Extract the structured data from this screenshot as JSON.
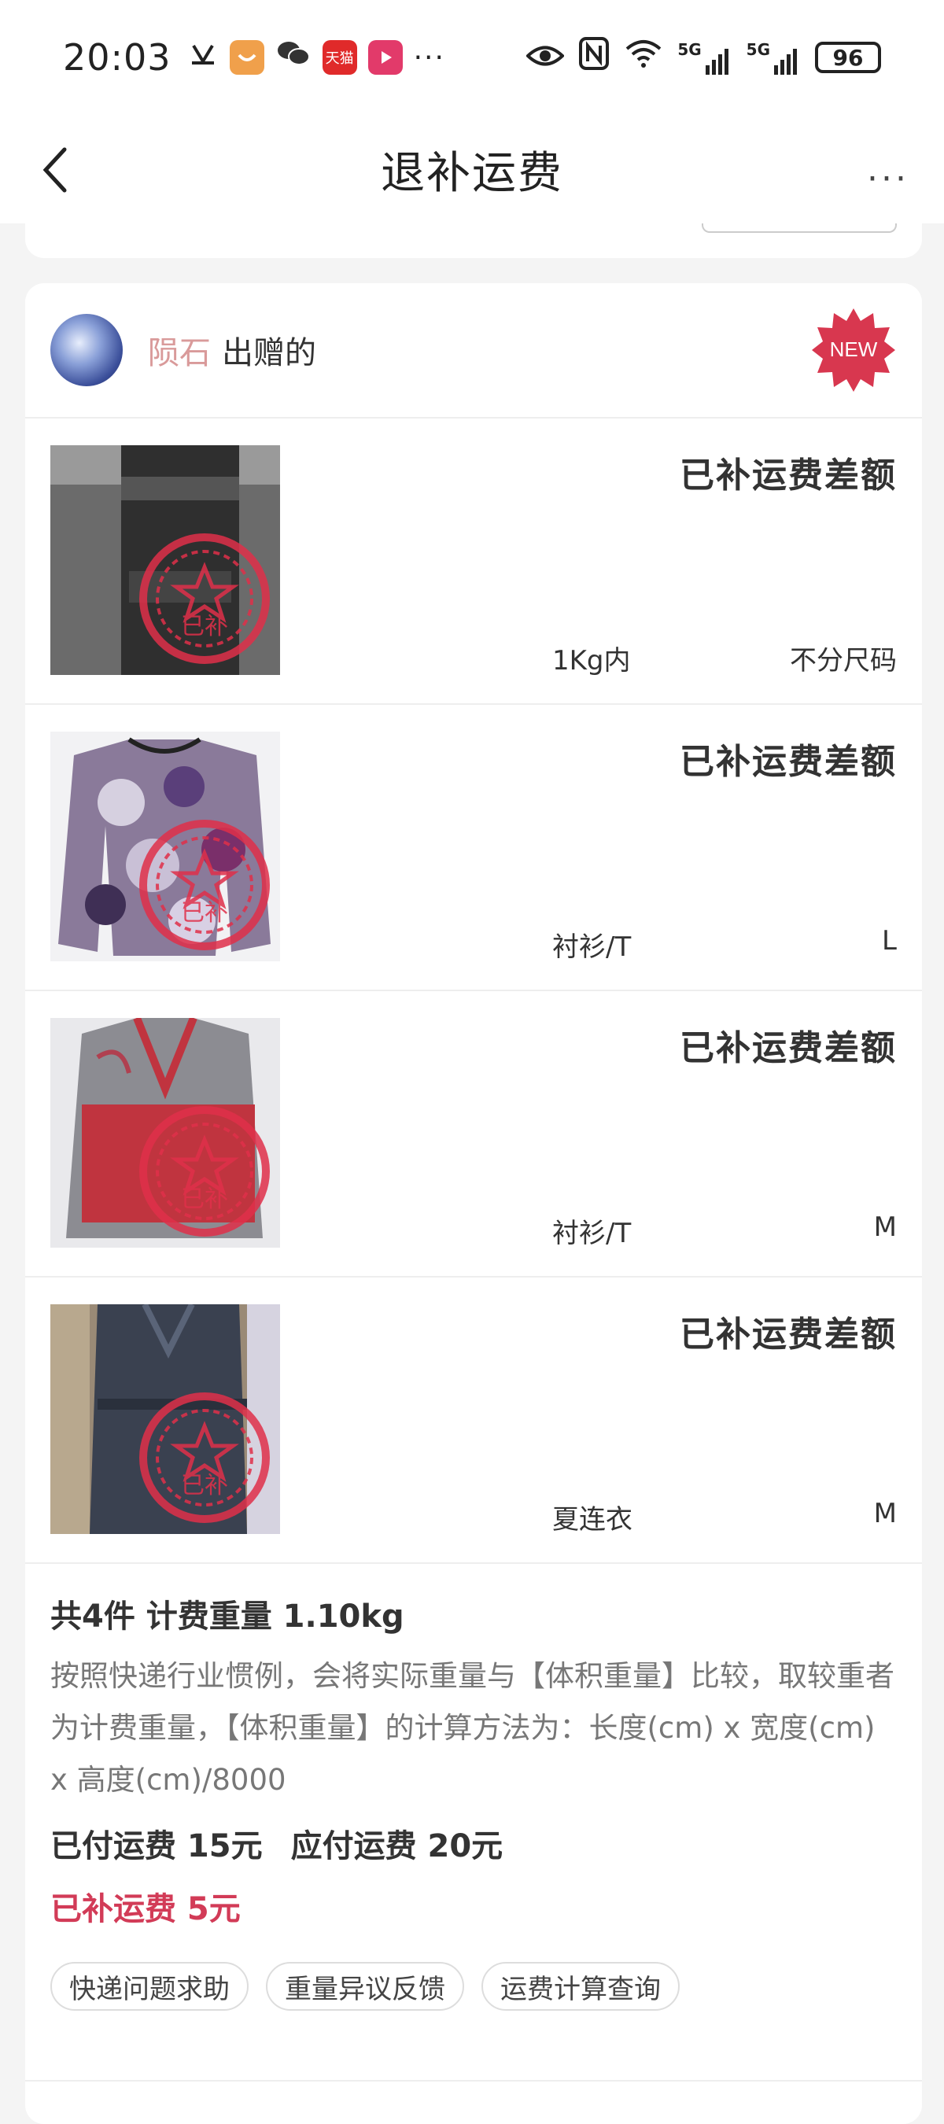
{
  "status_bar": {
    "time": "20:03",
    "battery": "96",
    "tmall_label": "天猫",
    "network_left": "5G",
    "network_right": "5G",
    "icons": [
      "silent-icon",
      "shield-app-icon",
      "wechat-icon",
      "tmall-app-icon",
      "video-app-icon",
      "more-notifications-icon",
      "eye-icon",
      "nfc-icon",
      "wifi-icon",
      "signal-icon",
      "signal-icon",
      "battery-icon"
    ]
  },
  "nav": {
    "title": "退补运费",
    "more": "···"
  },
  "donor": {
    "name": "陨石",
    "suffix": "出赠的",
    "badge": "NEW"
  },
  "items": [
    {
      "status": "已补运费差额",
      "category": "1Kg内",
      "size": "不分尺码",
      "stamp": "已补"
    },
    {
      "status": "已补运费差额",
      "category": "衬衫/T",
      "size": "L",
      "stamp": "已补"
    },
    {
      "status": "已补运费差额",
      "category": "衬衫/T",
      "size": "M",
      "stamp": "已补"
    },
    {
      "status": "已补运费差额",
      "category": "夏连衣",
      "size": "M",
      "stamp": "已补"
    }
  ],
  "summary": {
    "headline": "共4件 计费重量 1.10kg",
    "description": "按照快递行业惯例，会将实际重量与【体积重量】比较，取较重者为计费重量，【体积重量】的计算方法为：长度(cm) x 宽度(cm) x 高度(cm)/8000",
    "paid": "已付运费 15元",
    "due": "应付运费 20元",
    "compensated": "已补运费 5元"
  },
  "tags": [
    "快递问题求助",
    "重量异议反馈",
    "运费计算查询"
  ],
  "colors": {
    "accent": "#d23b57",
    "donor_name": "#d99a9a",
    "stamp": "#e0304a"
  }
}
